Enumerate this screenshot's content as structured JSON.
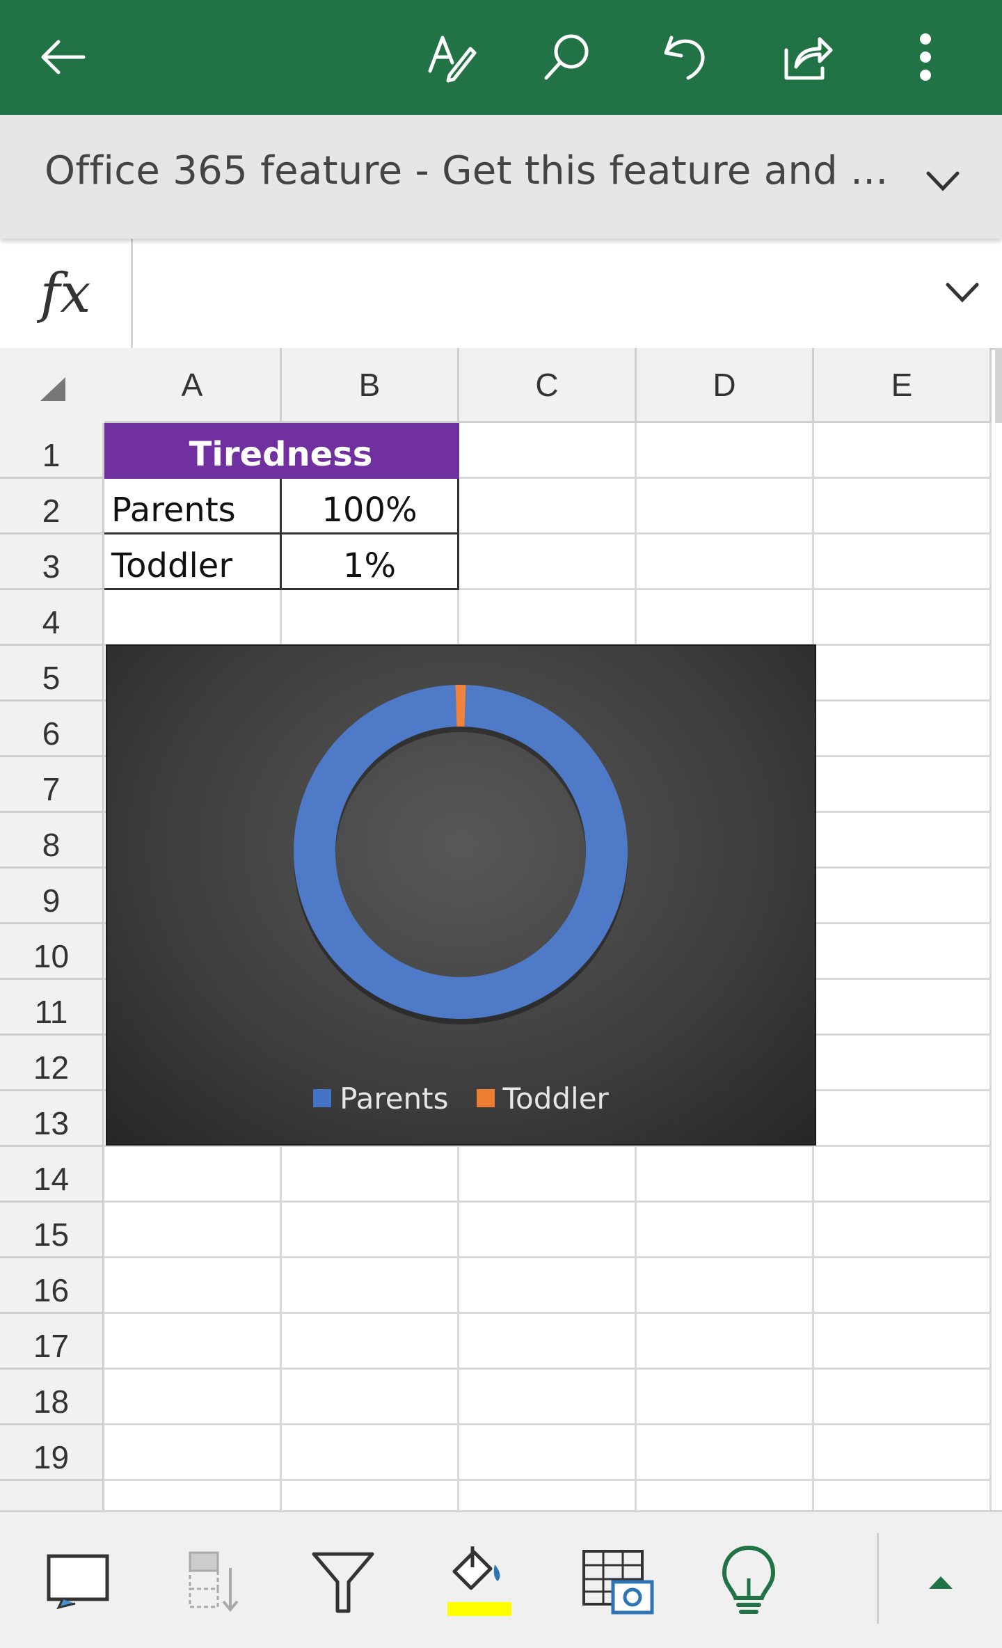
{
  "appbar": {
    "background": "#217346",
    "icons": [
      "back-arrow-icon",
      "edit-pen-icon",
      "search-icon",
      "undo-icon",
      "share-icon",
      "more-options-icon"
    ]
  },
  "banner": {
    "text": "Office 365 feature - Get this feature and ..."
  },
  "formula_bar": {
    "fx_label": "fx",
    "value": ""
  },
  "columns": [
    "A",
    "B",
    "C",
    "D",
    "E"
  ],
  "rows": [
    "1",
    "2",
    "3",
    "4",
    "5",
    "6",
    "7",
    "8",
    "9",
    "10",
    "11",
    "12",
    "13",
    "14",
    "15",
    "16",
    "17",
    "18",
    "19"
  ],
  "cells": {
    "A1": "Tiredness",
    "A2": "Parents",
    "B2": "100%",
    "A3": "Toddler",
    "B3": "1%"
  },
  "header_color": "#7030a0",
  "chart_data": {
    "type": "doughnut",
    "categories": [
      "Parents",
      "Toddler"
    ],
    "values": [
      100,
      1
    ],
    "colors": [
      "#4472c4",
      "#ed7d31"
    ],
    "legend": "bottom",
    "background": "#404040"
  },
  "bottombar": {
    "icons": [
      "comment-icon",
      "sort-icon",
      "filter-icon",
      "fill-color-icon",
      "table-camera-icon",
      "lightbulb-icon",
      "expand-up-icon"
    ],
    "fill_highlight": "#ffff00"
  }
}
